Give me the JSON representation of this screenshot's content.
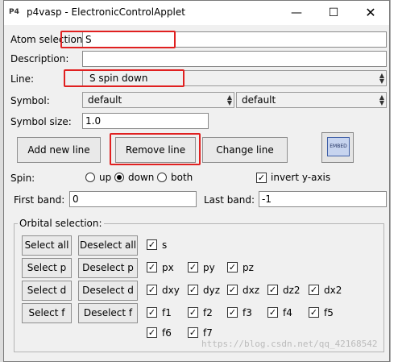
{
  "window": {
    "title": "p4vasp - ElectronicControlApplet",
    "icon_text": "P4",
    "buttons": [
      "minimize-icon",
      "maximize-icon",
      "close-icon"
    ]
  },
  "atom_selection": {
    "label": "Atom selection:",
    "value": "S"
  },
  "description": {
    "label": "Description:",
    "value": ""
  },
  "line": {
    "label": "Line:",
    "value": "S spin down"
  },
  "symbol": {
    "label": "Symbol:",
    "value1": "default",
    "value2": "default"
  },
  "symbol_size": {
    "label": "Symbol size:",
    "value": "1.0"
  },
  "actions": {
    "add": "Add new line",
    "remove": "Remove line",
    "change": "Change line",
    "embed": "EMBED"
  },
  "spin": {
    "label": "Spin:",
    "options": [
      "up",
      "down",
      "both"
    ],
    "selected": "down",
    "invert_label": "invert y-axis",
    "invert_checked": true
  },
  "bands": {
    "first_label": "First band:",
    "first_value": "0",
    "last_label": "Last band:",
    "last_value": "-1"
  },
  "orbital": {
    "legend": "Orbital selection:",
    "rows": [
      {
        "select": "Select all",
        "deselect": "Deselect all",
        "items": [
          "s"
        ]
      },
      {
        "select": "Select p",
        "deselect": "Deselect p",
        "items": [
          "px",
          "py",
          "pz"
        ]
      },
      {
        "select": "Select d",
        "deselect": "Deselect d",
        "items": [
          "dxy",
          "dyz",
          "dxz",
          "dz2",
          "dx2"
        ]
      },
      {
        "select": "Select f",
        "deselect": "Deselect f",
        "items": [
          "f1",
          "f2",
          "f3",
          "f4",
          "f5"
        ]
      },
      {
        "select": "",
        "deselect": "",
        "items": [
          "f6",
          "f7"
        ]
      }
    ]
  },
  "watermark": "https://blog.csdn.net/qq_42168542",
  "colors": {
    "highlight": "#e02020",
    "field_bg": "#ffffff",
    "window_bg": "#f0f0f0"
  }
}
